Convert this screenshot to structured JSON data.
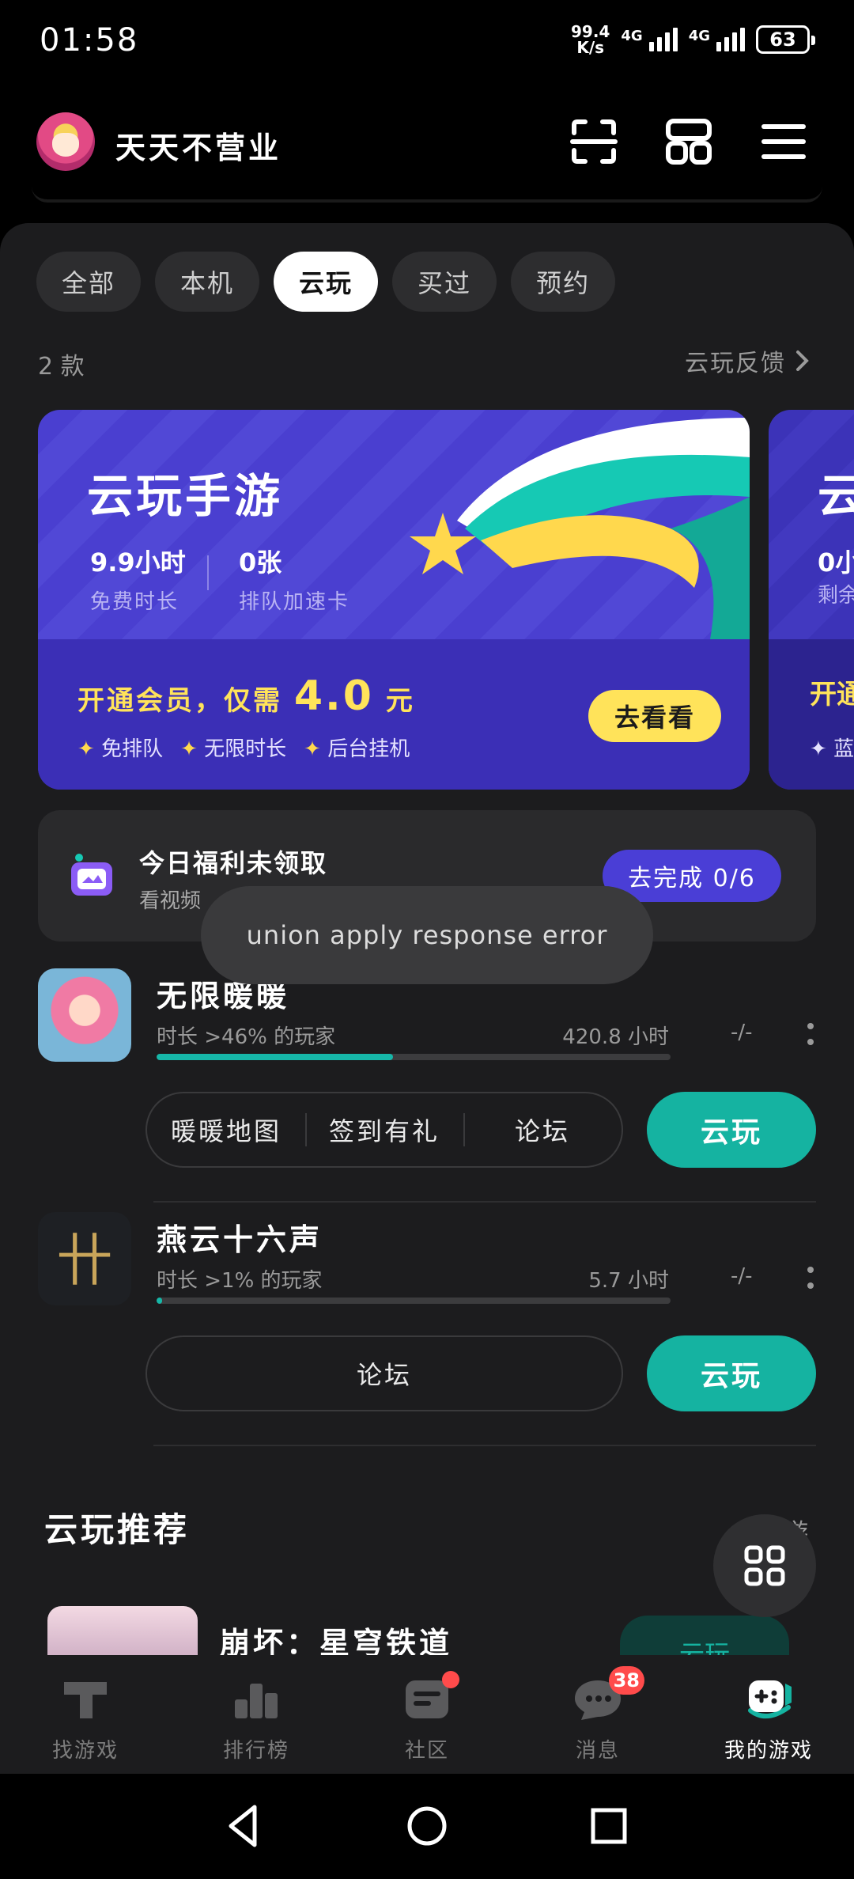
{
  "status_bar": {
    "time": "01:58",
    "net_speed_value": "99.4",
    "net_speed_unit": "K/s",
    "sig1_label": "4G",
    "sig2_label": "4G",
    "battery": "63"
  },
  "header": {
    "username": "天天不营业"
  },
  "tabs": [
    {
      "label": "全部",
      "active": false
    },
    {
      "label": "本机",
      "active": false
    },
    {
      "label": "云玩",
      "active": true
    },
    {
      "label": "买过",
      "active": false
    },
    {
      "label": "预约",
      "active": false
    }
  ],
  "list_info": {
    "count": "2 款",
    "feedback": "云玩反馈"
  },
  "banner": {
    "title": "云玩手游",
    "stat1_value": "9.9小时",
    "stat1_label": "免费时长",
    "stat2_value": "0张",
    "stat2_label": "排队加速卡",
    "promo_prefix": "开通会员，仅需",
    "promo_price": "4.0",
    "promo_unit": "元",
    "perks": [
      "免排队",
      "无限时长",
      "后台挂机"
    ],
    "button": "去看看"
  },
  "banner2": {
    "title": "云",
    "stat": "0小",
    "stat_label": "剩余",
    "promo": "开通",
    "perk": "蓝"
  },
  "welfare": {
    "title": "今日福利未领取",
    "subtitle": "看视频",
    "button": "去完成 0/6"
  },
  "games": [
    {
      "name": "无限暖暖",
      "meta": "时长 >46% 的玩家",
      "hours": "420.8 小时",
      "dash": "-/-",
      "progress": 0.46,
      "chips": [
        "暖暖地图",
        "签到有礼",
        "论坛"
      ],
      "button": "云玩"
    },
    {
      "name": "燕云十六声",
      "meta": "时长 >1% 的玩家",
      "hours": "5.7 小时",
      "dash": "-/-",
      "progress": 0.01,
      "chips": [
        "论坛"
      ],
      "button": "云玩"
    }
  ],
  "recommend": {
    "title": "云玩推荐",
    "all": "全部游",
    "game_name": "崩坏：星穹铁道",
    "button": "云玩"
  },
  "toast": "union apply response error",
  "bottom_nav": [
    {
      "label": "找游戏",
      "icon": "find-game-icon",
      "active": false
    },
    {
      "label": "排行榜",
      "icon": "ranking-icon",
      "active": false
    },
    {
      "label": "社区",
      "icon": "community-icon",
      "active": false,
      "dot": true
    },
    {
      "label": "消息",
      "icon": "message-icon",
      "active": false,
      "badge": "38"
    },
    {
      "label": "我的游戏",
      "icon": "my-games-icon",
      "active": true
    }
  ],
  "colors": {
    "accent_teal": "#15b3a1",
    "banner_purple": "#4a3fd0",
    "promo_yellow": "#ffe35a",
    "badge_red": "#ff4b4b"
  }
}
